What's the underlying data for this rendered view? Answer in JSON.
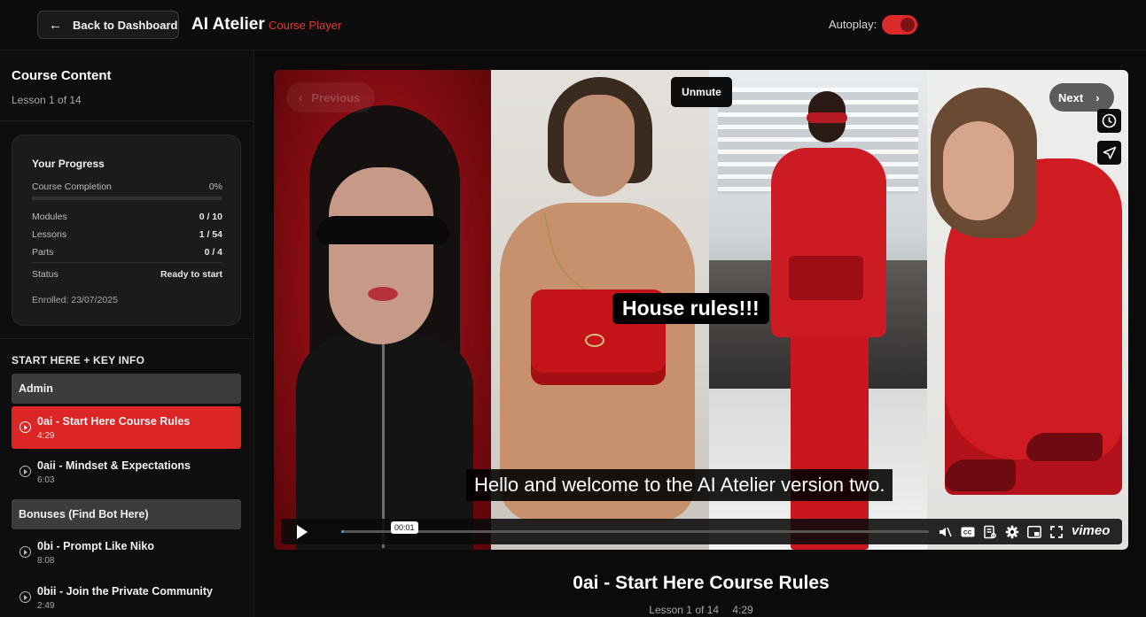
{
  "header": {
    "back_label": "Back to Dashboard",
    "brand": "AI Atelier",
    "brand_sub": "Course Player",
    "autoplay_label": "Autoplay:",
    "autoplay_on": true,
    "accent_color": "#dc2626"
  },
  "sidebar": {
    "title": "Course Content",
    "lesson_count": "Lesson 1 of 14",
    "progress": {
      "title": "Your Progress",
      "completion_label": "Course Completion",
      "completion_value": "0%",
      "completion_fraction": 0,
      "modules_label": "Modules",
      "modules_value": "0 / 10",
      "lessons_label": "Lessons",
      "lessons_value": "1 / 54",
      "parts_label": "Parts",
      "parts_value": "0 / 4",
      "status_label": "Status",
      "status_value": "Ready to start",
      "enrolled": "Enrolled: 23/07/2025"
    },
    "section_title": "START HERE + KEY INFO",
    "modules": [
      {
        "title": "Admin",
        "lessons": [
          {
            "title": "0ai - Start Here Course Rules",
            "duration": "4:29",
            "active": true
          },
          {
            "title": "0aii - Mindset & Expectations",
            "duration": "6:03",
            "active": false
          }
        ]
      },
      {
        "title": "Bonuses (Find Bot Here)",
        "lessons": [
          {
            "title": "0bi - Prompt Like Niko",
            "duration": "8:08",
            "active": false
          },
          {
            "title": "0bii - Join the Private Community",
            "duration": "2:49",
            "active": false
          }
        ]
      }
    ]
  },
  "player": {
    "unmute_label": "Unmute",
    "previous_label": "Previous",
    "next_label": "Next",
    "caption_top": "House rules!!!",
    "caption_bottom": "Hello and welcome to the AI Atelier version two.",
    "current_time": "00:01",
    "progress_fraction": 0.004,
    "brand_logo": "vimeo",
    "side_icons": [
      "clock-icon",
      "send-icon"
    ],
    "control_icons": [
      "mute-icon",
      "cc-icon",
      "transcript-icon",
      "settings-icon",
      "pip-icon",
      "fullscreen-icon"
    ]
  },
  "lesson": {
    "title": "0ai - Start Here Course Rules",
    "position": "Lesson 1 of 14",
    "duration": "4:29"
  }
}
